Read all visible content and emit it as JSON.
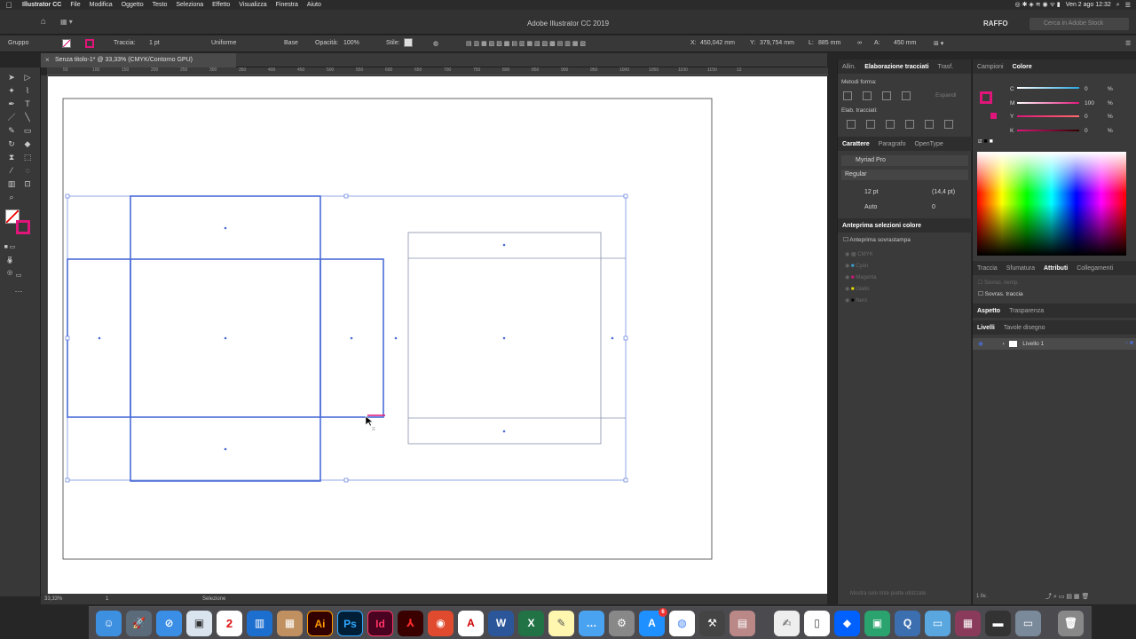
{
  "menubar": {
    "app": "Illustrator CC",
    "items": [
      "File",
      "Modifica",
      "Oggetto",
      "Testo",
      "Seleziona",
      "Effetto",
      "Visualizza",
      "Finestra",
      "Aiuto"
    ],
    "clock": "Ven 2 ago 12:32"
  },
  "appbar": {
    "title": "Adobe Illustrator CC 2019",
    "user": "RAFFO",
    "search_placeholder": "Cerca in Adobe Stock"
  },
  "controlbar": {
    "selection": "Gruppo",
    "stroke_label": "Traccia:",
    "stroke_value": "1 pt",
    "profile": "Uniforme",
    "brush": "Base",
    "opacity_label": "Opacità:",
    "opacity_value": "100%",
    "style_label": "Stile:",
    "x_label": "X:",
    "x_value": "450,042 mm",
    "y_label": "Y:",
    "y_value": "379,754 mm",
    "w_label": "L:",
    "w_value": "885 mm",
    "h_label": "A:",
    "h_value": "450 mm"
  },
  "document": {
    "tab_title": "Senza titolo-1* @ 33,33% (CMYK/Contorno GPU)"
  },
  "ruler": {
    "top_ticks": [
      "50",
      "100",
      "150",
      "200",
      "250",
      "300",
      "350",
      "400",
      "450",
      "500",
      "550",
      "600",
      "650",
      "700",
      "750",
      "800",
      "850",
      "900",
      "950",
      "1000",
      "1050",
      "1100",
      "1150",
      "12"
    ]
  },
  "status": {
    "zoom": "33,33%",
    "artboard": "1",
    "tool": "Selezione"
  },
  "panelL": {
    "tabs1": [
      "Allin.",
      "Elaborazione tracciati",
      "Trasf."
    ],
    "shape_modes": "Metodi forma:",
    "expand": "Espandi",
    "pathfinders": "Elab. tracciati:",
    "tabs2": [
      "Carattere",
      "Paragrafo",
      "OpenType"
    ],
    "font": "Myriad Pro",
    "style": "Regular",
    "size": "12 pt",
    "leading": "(14,4 pt)",
    "kerning": "Auto",
    "tracking": "0",
    "sep_title": "Anteprima selezioni colore",
    "overprint": "Anteprima sovrastampa",
    "seps": [
      "CMYK",
      "Cyan",
      "Magenta",
      "Giallo",
      "Nero"
    ],
    "footer": "Mostra solo tinte piatte utilizzate"
  },
  "panelR": {
    "tabs1": [
      "Campioni",
      "Colore"
    ],
    "cmyk": [
      {
        "label": "C",
        "value": "0"
      },
      {
        "label": "M",
        "value": "100"
      },
      {
        "label": "Y",
        "value": "0"
      },
      {
        "label": "K",
        "value": "0"
      }
    ],
    "pct": "%",
    "tabs2": [
      "Traccia",
      "Sfumatura",
      "Attributi",
      "Collegamenti"
    ],
    "overprint_fill": "Sovras. riemp.",
    "overprint_stroke": "Sovras. traccia",
    "tabs3": [
      "Aspetto",
      "Trasparenza"
    ],
    "tabs4": [
      "Livelli",
      "Tavole disegno"
    ],
    "layer": "Livello 1",
    "layers_count": "1 liv."
  },
  "colors": {
    "selection": "#4a6cd8",
    "fill_magenta": "#e0157a"
  },
  "dock": {
    "calendar_day": "2",
    "notification": "6"
  }
}
